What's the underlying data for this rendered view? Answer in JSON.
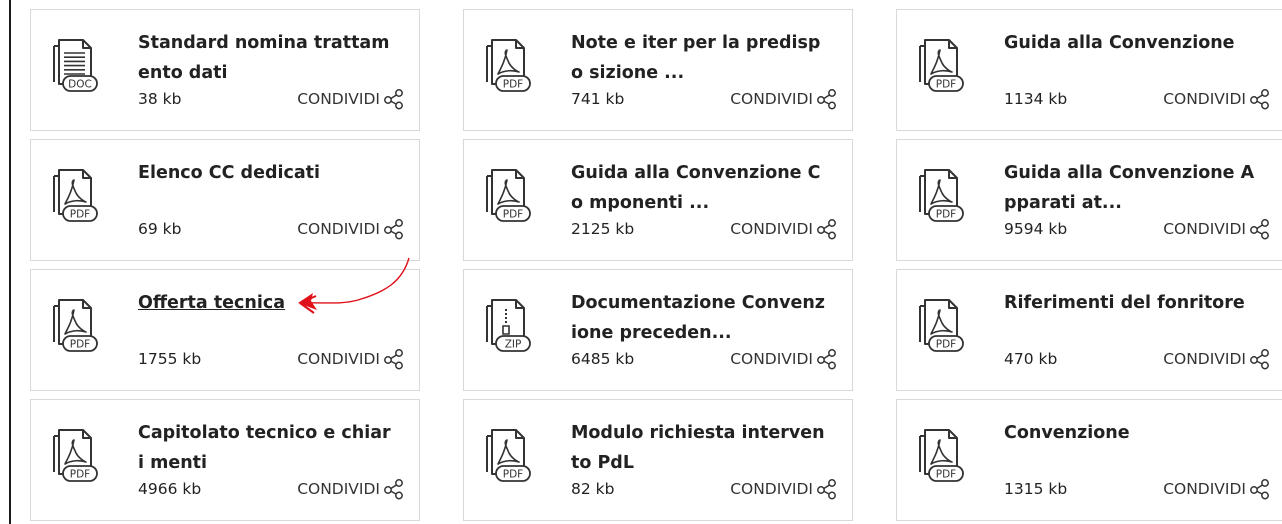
{
  "share_label": "CONDIVIDI",
  "files": [
    {
      "title": "Standard nomina trattam ento dati",
      "size": "38 kb",
      "type": "DOC",
      "icon": "doc-file-icon"
    },
    {
      "title": "Note e iter per la predispo sizione ...",
      "size": "741 kb",
      "type": "PDF",
      "icon": "pdf-file-icon"
    },
    {
      "title": "Guida alla Convenzione",
      "size": "1134 kb",
      "type": "PDF",
      "icon": "pdf-file-icon"
    },
    {
      "title": "Elenco CC dedicati",
      "size": "69 kb",
      "type": "PDF",
      "icon": "pdf-file-icon"
    },
    {
      "title": "Guida alla Convenzione Co mponenti ...",
      "size": "2125 kb",
      "type": "PDF",
      "icon": "pdf-file-icon"
    },
    {
      "title": "Guida alla Convenzione A pparati at...",
      "size": "9594 kb",
      "type": "PDF",
      "icon": "pdf-file-icon"
    },
    {
      "title": "Offerta tecnica",
      "size": "1755 kb",
      "type": "PDF",
      "icon": "pdf-file-icon",
      "underlined": true
    },
    {
      "title": "Documentazione Convenz ione preceden...",
      "size": "6485 kb",
      "type": "ZIP",
      "icon": "zip-file-icon"
    },
    {
      "title": "Riferimenti del fonritore",
      "size": "470 kb",
      "type": "PDF",
      "icon": "pdf-file-icon"
    },
    {
      "title": "Capitolato tecnico e chiari menti",
      "size": "4966 kb",
      "type": "PDF",
      "icon": "pdf-file-icon"
    },
    {
      "title": "Modulo richiesta interven to PdL",
      "size": "82 kb",
      "type": "PDF",
      "icon": "pdf-file-icon"
    },
    {
      "title": "Convenzione",
      "size": "1315 kb",
      "type": "PDF",
      "icon": "pdf-file-icon"
    }
  ],
  "annotation": {
    "icon": "red-arrow-annotation",
    "color": "#e0101a"
  }
}
